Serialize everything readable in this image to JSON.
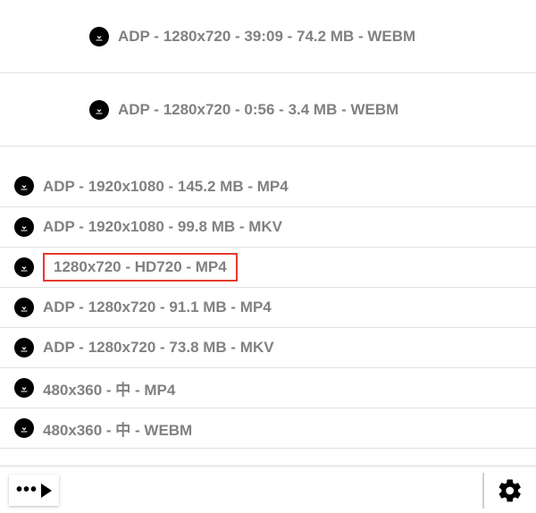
{
  "items": [
    {
      "label": "ADP - 1280x720 - 39:09 - 74.2 MB - WEBM",
      "highlighted": false,
      "spaced": true
    },
    {
      "label": "ADP - 1280x720 - 0:56 - 3.4 MB - WEBM",
      "highlighted": false,
      "spaced": true
    },
    {
      "label": "ADP - 1920x1080 - 145.2 MB - MP4",
      "highlighted": false,
      "spaced": false,
      "firstcompact": true
    },
    {
      "label": "ADP - 1920x1080 - 99.8 MB - MKV",
      "highlighted": false,
      "spaced": false
    },
    {
      "label": "1280x720 - HD720 - MP4",
      "highlighted": true,
      "spaced": false
    },
    {
      "label": "ADP - 1280x720 - 91.1 MB - MP4",
      "highlighted": false,
      "spaced": false
    },
    {
      "label": "ADP - 1280x720 - 73.8 MB - MKV",
      "highlighted": false,
      "spaced": false
    },
    {
      "label": "480x360 - 中 - MP4",
      "highlighted": false,
      "spaced": false
    },
    {
      "label": "480x360 - 中 - WEBM",
      "highlighted": false,
      "spaced": false
    }
  ],
  "footer": {
    "more": "•••",
    "settings": "settings"
  }
}
